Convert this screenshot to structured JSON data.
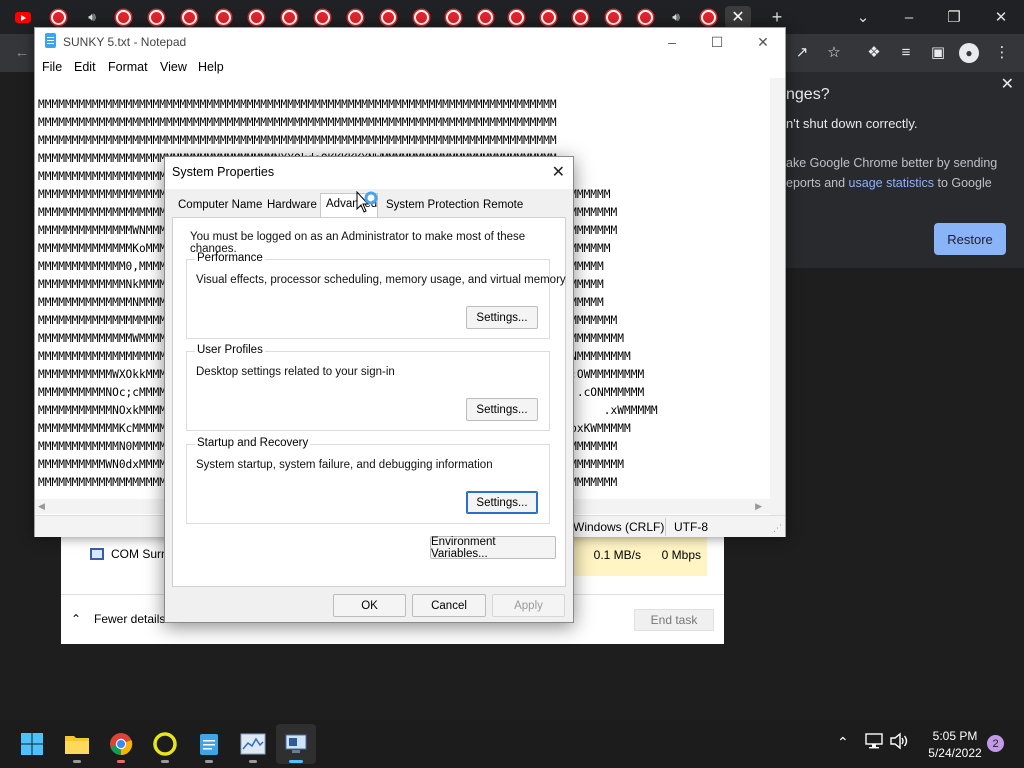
{
  "chrome": {
    "tab_count": 22,
    "bubble": {
      "title": "nges?",
      "line1": "n't shut down correctly.",
      "line2": "ake Google Chrome better by sending",
      "line3_pre": "eports and ",
      "line3_link": "usage statistics",
      "line3_post": " to Google",
      "restore_label": "Restore"
    }
  },
  "taskmgr": {
    "row_name": "COM Surr",
    "disk": "0.1 MB/s",
    "network": "0 Mbps",
    "fewer_details": "Fewer details",
    "end_task": "End task"
  },
  "notepad": {
    "title": "SUNKY 5.txt - Notepad",
    "menu": [
      "File",
      "Edit",
      "Format",
      "View",
      "Help"
    ],
    "lines": [
      "",
      "MMMMMMMMMMMMMMMMMMMMMMMMMMMMMMMMMMMMMMMMMMMMMMMMMMMMMMMMMMMMMMMMMMMMMMMMMMMMM",
      "MMMMMMMMMMMMMMMMMMMMMMMMMMMMMMMMMMMMMMMMMMMMMMMMMMMMMMMMMMMMMMMMMMMMMMMMMMMMM",
      "MMMMMMMMMMMMMMMMMMMMMMMMMMMMMMMMMMMMMMMMMMMMMMMMMMMMMMMMMMMMMMMMMMMMMMMMMMMMM",
      "MMMMMMMMMMMMMMMMMMMMMMMMMMMMMMMMMMMNXXOkdoOKKKKKXNWMMMMMMMMMMMMMMMMMMMMMMMMMM",
      "MMMMMMMMMMMMMMMMMMMMMMMMMMMMMMMMMMMMMMMMMMMMMMMMMMMMMMNWMMMMMMMMMMMMMMMMMMMMM",
      "MMMMMMMMMMMMMMMMMMMMMMMMMMMMMMMMMMMMMMMMMMMMMMMMMMMMMMMMMMKOxdl;;c,lxOXWMMMMMMMMMMMMM",
      "MMMMMMMMMMMMMMMMMMMMMMMMMMMMMMMMMMMMMMMMMMMMMMMMMMMMMMMMMMMMMMMMMMM. .'ckNWMMMMMMMMMMM",
      "MMMMMMMMMMMMMMWNMMMMMMMMMMMMMMMMMMMMMMMMMMMMMMMMMMMMMMMMMMMMMMMMMMM..    .lXMMMMMMMMMM",
      "MMMMMMMMMMMMMMKoMMMMMMMMMMMMMMMMMMMMMMMMMMMMMMMMMMMMMMMMMMMMMMMMMMM.   ,o0WMMMMMMMMMM",
      "MMMMMMMMMMMMM0,MMMMMMMMMMMMMMMMMMMMMMMMMMMMMMMMMMMMMMMMMMMMMMMMMM..:dkXMMMMMMMMMMMMM",
      "MMMMMMMMMMMMMNkMMMMMMMMMMMMMMMMMMMMMMMMMMMMMMMMMMMMMMMMMMMMMMMMMMMlONMMMMMMMMMMMMMMM",
      "MMMMMMMMMMMMMMNMMMMMMMMMMMMMMMMMMMMMMMMMMMMMMMMMMMMMMMMMMMMMMMMMMMM,dKXWMMMMMMMMMMMM",
      "MMMMMMMMMMMMMMMMMMMMMMMMMMMMMMMMMMMMMMMMMMMMMMMMMMMMMMMMMMMMMMMMMMM. ..'cONMMMMMMMMMMM",
      "MMMMMMMMMMMMMMWMMMMMMMMMMMMMMMMMMMMMMMMMMMMMMMMMMMMMMMMMMMMMMMMMMMM...   .cOXWMMMMMMMMM",
      "MMMMMMMMMMMMMMMMMMMMMMMMMMMMMMMMMMMMMMMMMMMMMMMMMMMMMMMMMMMMMMMMMMM.''...  .'cONMMMMMMMM",
      "MMMMMMMMMMMWXOkkMMMMMMMMMMMMMMMMMMMMMMMMMMMMMMMMMMMMMMMMMMMMMMMMMM...'....    .:OWMMMMMMMM",
      "MMMMMMMMMMNOc;cMMMMMMMMMMMMMMMMMMMMMMMMMMMMMMMMMMMMMMMMMMMMMMMMMMM....  ...     .cONMMMMMM",
      "MMMMMMMMMMMNOxkMMMMMMMMMMMMMMMMMMMMMMMMMMMMMMMMMMMMMMMMMMMMMMMMMMM    .''...        .xWMMMMM",
      "MMMMMMMMMMMMKcMMMMMMMMMMMMMMMMMMMMMMMMMMMMMMMMMMMMMMMMMMMMMMMMMMMM.,:dkdolllllooxKWMMMMM",
      "MMMMMMMMMMMMN0MMMMMMMMMMMMMMMMMMMMMMMMMMMMMMMMMMMMMMMMMMMMMMMMMMMM.;c,''';xXWMMMMMMMMM",
      "MMMMMMMMMMWN0dxMMMMMMMMMMMMMMMMMMMMMMMMMMMMMMMMMMMMMMMMMMMMMMMMMMM,;.  .,'  'xNMMMMMMMM",
      "MMMMMMMMMMMMMMMMMMMMMMMMMMMMMMMMMMMMMMMMMMMMMMMMMMMMMMMMMMMMMMMMMMM',.'.0l..OWMMMMMMMM"
    ],
    "status_line_ending": "Windows (CRLF)",
    "status_encoding": "UTF-8"
  },
  "sysprops": {
    "title": "System Properties",
    "tabs": [
      "Computer Name",
      "Hardware",
      "Advanced",
      "System Protection",
      "Remote"
    ],
    "admin_msg": "You must be logged on as an Administrator to make most of these changes.",
    "groups": [
      {
        "label": "Performance",
        "desc": "Visual effects, processor scheduling, memory usage, and virtual memory",
        "button": "Settings..."
      },
      {
        "label": "User Profiles",
        "desc": "Desktop settings related to your sign-in",
        "button": "Settings..."
      },
      {
        "label": "Startup and Recovery",
        "desc": "System startup, system failure, and debugging information",
        "button": "Settings..."
      }
    ],
    "env_button": "Environment Variables...",
    "ok": "OK",
    "cancel": "Cancel",
    "apply": "Apply"
  },
  "taskbar": {
    "apps": [
      "start-icon",
      "file-explorer-icon",
      "chrome-icon",
      "circle-app-icon",
      "notepad-icon",
      "task-manager-icon",
      "system-properties-icon"
    ],
    "time": "5:05 PM",
    "date": "5/24/2022",
    "notification_count": "2"
  }
}
